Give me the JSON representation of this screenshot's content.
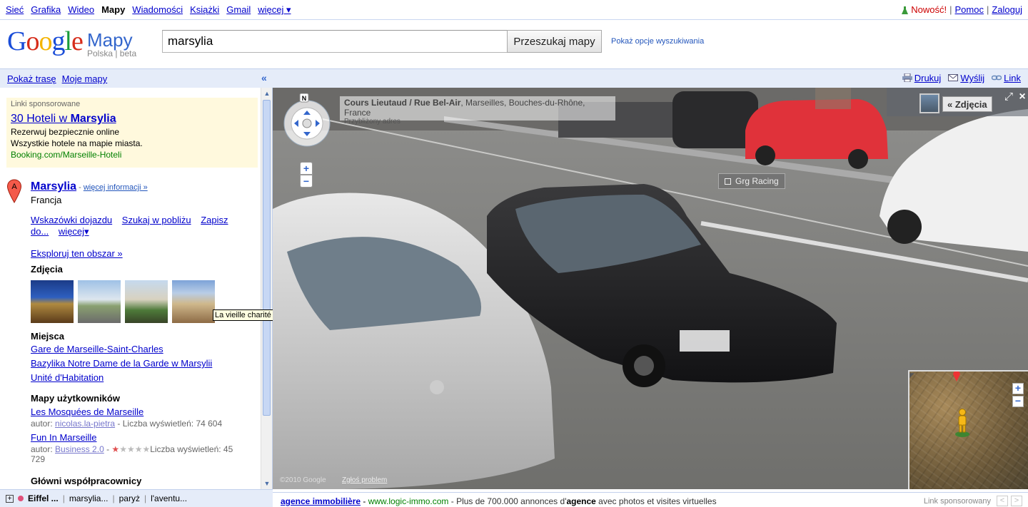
{
  "topbar": {
    "nav": [
      "Sieć",
      "Grafika",
      "Wideo",
      "Mapy",
      "Wiadomości",
      "Książki",
      "Gmail",
      "więcej ▾"
    ],
    "active": "Mapy",
    "new_label": "Nowość!",
    "help": "Pomoc",
    "login": "Zaloguj"
  },
  "header": {
    "logo_product": "Mapy",
    "logo_sub": "Polska | beta",
    "search_value": "marsylia",
    "search_button": "Przeszukaj mapy",
    "search_options": "Pokaż opcje wyszukiwania"
  },
  "leftbar": {
    "route": "Pokaż trasę",
    "my_maps": "Moje mapy",
    "collapse": "«"
  },
  "ads": {
    "label": "Linki sponsorowane",
    "title_prefix": "30 Hoteli w ",
    "title_bold": "Marsylia",
    "line1": "Rezerwuj bezpiecznie online",
    "line2": "Wszystkie hotele na mapie miasta.",
    "url": "Booking.com/Marseille-Hoteli"
  },
  "result": {
    "marker": "A",
    "title": "Marsylia",
    "dash": " - ",
    "more": "więcej informacji »",
    "country": "Francja",
    "actions": [
      "Wskazówki dojazdu",
      "Szukaj w pobliżu",
      "Zapisz do...",
      "więcej▾"
    ],
    "explore": "Eksploruj ten obszar »",
    "photos_title": "Zdjęcia",
    "tooltip": "La vieille charité",
    "places_title": "Miejsca",
    "places": [
      "Gare de Marseille-Saint-Charles",
      "Bazylika Notre Dame de la Garde w Marsylii",
      "Unité d'Habitation"
    ],
    "user_maps_title": "Mapy użytkowników",
    "user_maps": [
      {
        "title": "Les Mosquées de Marseille",
        "author_label": "autor: ",
        "author": "nicolas.la-pietra",
        "views": " - Liczba wyświetleń: 74 604"
      },
      {
        "title": "Fun In Marseille",
        "author_label": "autor: ",
        "author": "Business 2.0",
        "views": " - ",
        "views2": "Liczba wyświetleń: 45 729",
        "stars_on": "★",
        "stars_off": "★★★★"
      }
    ],
    "contributors_title": "Główni współpracownicy"
  },
  "bottombar": {
    "plus": "+",
    "items": [
      "Eiffel ...",
      "marsylia...",
      "paryż",
      "l'aventu..."
    ]
  },
  "rightbar": {
    "print": "Drukuj",
    "send": "Wyślij",
    "link": "Link"
  },
  "streetview": {
    "compass_n": "N",
    "street_a": "Cours Lieutaud",
    "street_sep": " / ",
    "street_b": "Rue Bel-Air",
    "city": ", Marseilles, Bouches-du-Rhône, France",
    "approx": "Przybliżony adres",
    "zoom_in": "+",
    "zoom_out": "−",
    "label_grg": "Grg Racing",
    "photos_button": "« Zdjęcia",
    "fullscreen": "⤢",
    "close": "×",
    "copyright": "©2010 Google",
    "report": "Zgłoś problem"
  },
  "minimap": {
    "zoom_in": "+",
    "zoom_out": "−"
  },
  "adbar": {
    "title": "agence immobilière",
    "dash": " - ",
    "url": "www.logic-immo.com",
    "desc_pre": " - Plus de 700.000 annonces d'",
    "desc_bold": "agence",
    "desc_post": " avec photos et visites virtuelles",
    "sponsor": "Link sponsorowany",
    "prev": "<",
    "next": ">"
  },
  "colors": {
    "link": "#0000cc",
    "toolbar_bg": "#e5ecf9",
    "ad_bg": "#fff9dd",
    "ad_url": "#008000"
  }
}
